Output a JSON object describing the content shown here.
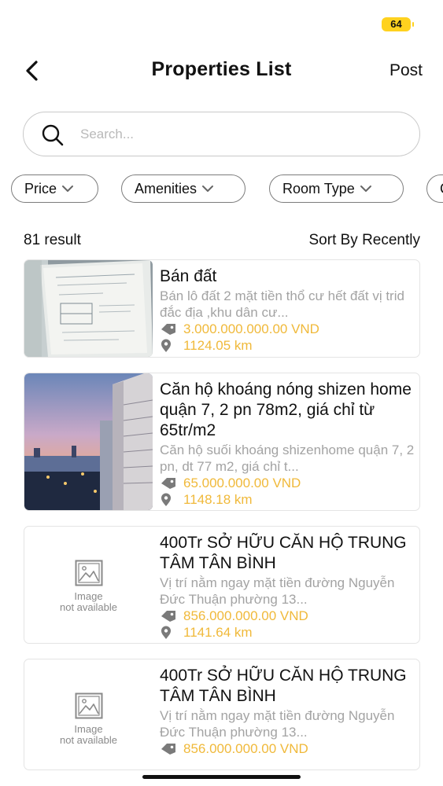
{
  "status_bar": {
    "battery": "64",
    "battery_color": "#ffd21f"
  },
  "header": {
    "title": "Properties List",
    "post_label": "Post",
    "back_icon": "chevron-left-icon"
  },
  "search": {
    "placeholder": "Search...",
    "value": ""
  },
  "filters": [
    "Price",
    "Amenities",
    "Room Type",
    "C"
  ],
  "results": {
    "count_label": "81 result",
    "sort_label": "Sort By Recently"
  },
  "listings": [
    {
      "title": "Bán đất",
      "description": "Bán lô đất 2 mặt tiền thổ cư hết đất vị trid đắc địa ,khu dân cư...",
      "price": "3.000.000.000.00 VND",
      "distance": "1124.05 km",
      "image": "document-photo"
    },
    {
      "title": "Căn hộ khoáng nóng shizen home quận 7, 2 pn 78m2, giá chỉ từ 65tr/m2",
      "description": "Căn hộ suối khoáng shizenhome quận 7, 2 pn, dt 77 m2, giá chỉ t...",
      "price": "65.000.000.00 VND",
      "distance": "1148.18 km",
      "image": "building-photo"
    },
    {
      "title": "400Tr SỞ HỮU CĂN HỘ TRUNG TÂM TÂN BÌNH",
      "description": "Vị trí nằm ngay mặt tiền đường Nguyễn Đức Thuận phường 13...",
      "price": "856.000.000.00 VND",
      "distance": "1141.64 km",
      "image_placeholder_line1": "Image",
      "image_placeholder_line2": "not available"
    },
    {
      "title": "400Tr SỞ HỮU CĂN HỘ TRUNG TÂM TÂN BÌNH",
      "description": "Vị trí nằm ngay mặt tiền đường Nguyễn Đức Thuận phường 13...",
      "price": "856.000.000.00 VND",
      "image_placeholder_line1": "Image",
      "image_placeholder_line2": "not available"
    }
  ],
  "colors": {
    "accent": "#f0b93a",
    "muted_text": "#a3a3a3",
    "border": "#e4e4e4"
  }
}
